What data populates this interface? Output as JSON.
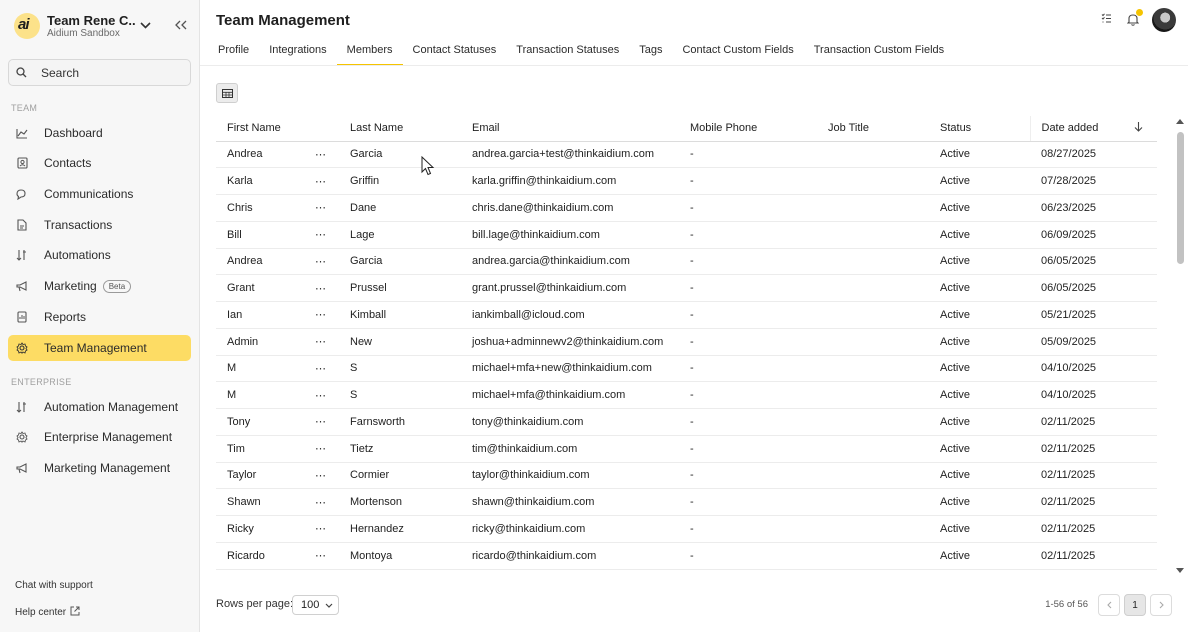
{
  "sidebar": {
    "logo_text": "ai",
    "team_name": "Team Rene C...",
    "team_sub": "Aidium Sandbox",
    "search_placeholder": "Search",
    "section_team": "TEAM",
    "section_enterprise": "ENTERPRISE",
    "team_items": [
      {
        "label": "Dashboard",
        "icon": "chart-line-icon"
      },
      {
        "label": "Contacts",
        "icon": "contacts-icon"
      },
      {
        "label": "Communications",
        "icon": "chat-icon"
      },
      {
        "label": "Transactions",
        "icon": "document-icon"
      },
      {
        "label": "Automations",
        "icon": "automation-icon"
      },
      {
        "label": "Marketing",
        "icon": "megaphone-icon",
        "badge": "Beta"
      },
      {
        "label": "Reports",
        "icon": "report-icon"
      },
      {
        "label": "Team Management",
        "icon": "gear-icon",
        "active": true
      }
    ],
    "enterprise_items": [
      {
        "label": "Automation Management",
        "icon": "automation-icon"
      },
      {
        "label": "Enterprise Management",
        "icon": "gear-icon"
      },
      {
        "label": "Marketing Management",
        "icon": "megaphone-icon"
      }
    ],
    "chat_support": "Chat with support",
    "help_center": "Help center"
  },
  "main": {
    "title": "Team Management",
    "notification_color": "#f5c400",
    "accent_color": "#fddc64",
    "tabs": [
      {
        "label": "Profile"
      },
      {
        "label": "Integrations"
      },
      {
        "label": "Members",
        "active": true
      },
      {
        "label": "Contact Statuses"
      },
      {
        "label": "Transaction Statuses"
      },
      {
        "label": "Tags"
      },
      {
        "label": "Contact Custom Fields"
      },
      {
        "label": "Transaction Custom Fields"
      }
    ],
    "table": {
      "columns": [
        "First Name",
        "Last Name",
        "Email",
        "Mobile Phone",
        "Job Title",
        "Status",
        "Date added"
      ],
      "rows": [
        [
          "Andrea",
          "Garcia",
          "andrea.garcia+test@thinkaidium.com",
          "-",
          "",
          "Active",
          "08/27/2025"
        ],
        [
          "Karla",
          "Griffin",
          "karla.griffin@thinkaidium.com",
          "-",
          "",
          "Active",
          "07/28/2025"
        ],
        [
          "Chris",
          "Dane",
          "chris.dane@thinkaidium.com",
          "-",
          "",
          "Active",
          "06/23/2025"
        ],
        [
          "Bill",
          "Lage",
          "bill.lage@thinkaidium.com",
          "-",
          "",
          "Active",
          "06/09/2025"
        ],
        [
          "Andrea",
          "Garcia",
          "andrea.garcia@thinkaidium.com",
          "-",
          "",
          "Active",
          "06/05/2025"
        ],
        [
          "Grant",
          "Prussel",
          "grant.prussel@thinkaidium.com",
          "-",
          "",
          "Active",
          "06/05/2025"
        ],
        [
          "Ian",
          "Kimball",
          "iankimball@icloud.com",
          "-",
          "",
          "Active",
          "05/21/2025"
        ],
        [
          "Admin",
          "New",
          "joshua+adminnewv2@thinkaidium.com",
          "-",
          "",
          "Active",
          "05/09/2025"
        ],
        [
          "M",
          "S",
          "michael+mfa+new@thinkaidium.com",
          "-",
          "",
          "Active",
          "04/10/2025"
        ],
        [
          "M",
          "S",
          "michael+mfa@thinkaidium.com",
          "-",
          "",
          "Active",
          "04/10/2025"
        ],
        [
          "Tony",
          "Farnsworth",
          "tony@thinkaidium.com",
          "-",
          "",
          "Active",
          "02/11/2025"
        ],
        [
          "Tim",
          "Tietz",
          "tim@thinkaidium.com",
          "-",
          "",
          "Active",
          "02/11/2025"
        ],
        [
          "Taylor",
          "Cormier",
          "taylor@thinkaidium.com",
          "-",
          "",
          "Active",
          "02/11/2025"
        ],
        [
          "Shawn",
          "Mortenson",
          "shawn@thinkaidium.com",
          "-",
          "",
          "Active",
          "02/11/2025"
        ],
        [
          "Ricky",
          "Hernandez",
          "ricky@thinkaidium.com",
          "-",
          "",
          "Active",
          "02/11/2025"
        ],
        [
          "Ricardo",
          "Montoya",
          "ricardo@thinkaidium.com",
          "-",
          "",
          "Active",
          "02/11/2025"
        ]
      ]
    },
    "footer": {
      "rows_per_page_label": "Rows per page:",
      "rows_per_page_value": "100",
      "range": "1-56 of 56",
      "current_page": "1"
    }
  }
}
